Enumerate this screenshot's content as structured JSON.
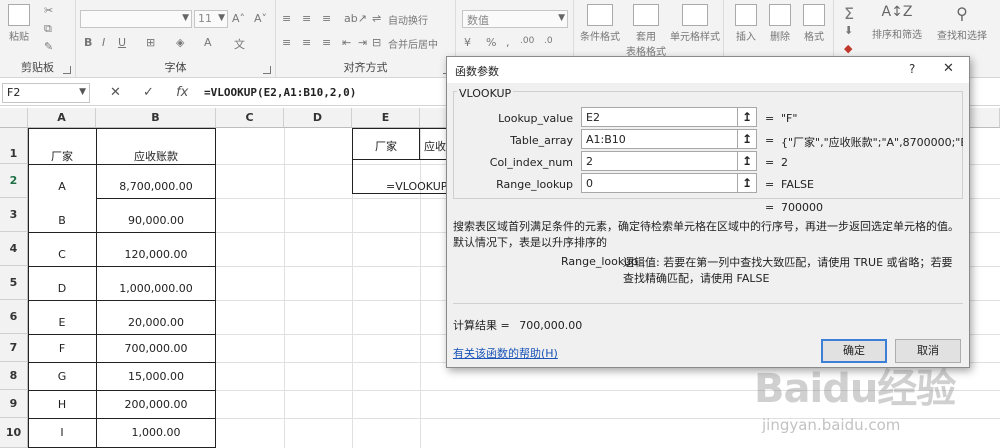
{
  "ribbon": {
    "clipboard": {
      "paste_label": "粘贴",
      "group_label": "剪贴板"
    },
    "font": {
      "font_size": "11",
      "group_label": "字体"
    },
    "alignment": {
      "wrap_label": "自动换行",
      "merge_label": "合并后居中",
      "group_label": "对齐方式"
    },
    "number": {
      "format_value": "数值"
    },
    "styles": {
      "conditional_label": "条件格式",
      "table_label_1": "套用",
      "table_label_2": "表格格式",
      "cell_styles_label": "单元格样式"
    },
    "cells": {
      "insert_label": "插入",
      "delete_label": "删除",
      "format_label": "格式"
    },
    "editing": {
      "sort_label": "排序和筛选",
      "find_label": "查找和选择"
    }
  },
  "formula_bar": {
    "name_box": "F2",
    "fx_label": "fx",
    "formula": "=VLOOKUP(E2,A1:B10,2,0)"
  },
  "grid": {
    "columns": [
      "A",
      "B",
      "C",
      "D",
      "E"
    ],
    "rows": [
      "1",
      "2",
      "3",
      "4",
      "5",
      "6",
      "7",
      "8",
      "9",
      "10"
    ],
    "header_row": {
      "a": "厂家",
      "b": "应收账款"
    },
    "data": [
      {
        "a": "A",
        "b": "8,700,000.00"
      },
      {
        "a": "B",
        "b": "90,000.00"
      },
      {
        "a": "C",
        "b": "120,000.00"
      },
      {
        "a": "D",
        "b": "1,000,000.00"
      },
      {
        "a": "E",
        "b": "20,000.00"
      },
      {
        "a": "F",
        "b": "700,000.00"
      },
      {
        "a": "G",
        "b": "15,000.00"
      },
      {
        "a": "H",
        "b": "200,000.00"
      },
      {
        "a": "I",
        "b": "1,000.00"
      }
    ],
    "e1": "厂家",
    "f1_partial": "应收",
    "e2": "=VLOOKUP"
  },
  "dialog": {
    "title": "函数参数",
    "help_glyph": "?",
    "close_glyph": "✕",
    "function_name": "VLOOKUP",
    "params": [
      {
        "label": "Lookup_value",
        "input": "E2",
        "result": "\"F\""
      },
      {
        "label": "Table_array",
        "input": "A1:B10",
        "result": "{\"厂家\",\"应收账款\";\"A\",8700000;\"B\",900"
      },
      {
        "label": "Col_index_num",
        "input": "2",
        "result": "2"
      },
      {
        "label": "Range_lookup",
        "input": "0",
        "result": "FALSE"
      }
    ],
    "eq": "=",
    "overall_result": "700000",
    "description": "搜索表区域首列满足条件的元素，确定待检索单元格在区域中的行序号，再进一步返回选定单元格的值。默认情况下，表是以升序排序的",
    "arg_name": "Range_lookup",
    "arg_description": "逻辑值: 若要在第一列中查找大致匹配，请使用 TRUE 或省略；若要查找精确匹配，请使用 FALSE",
    "calc_result_label": "计算结果 =",
    "calc_result_value": "700,000.00",
    "help_link": "有关该函数的帮助(H)",
    "ok_label": "确定",
    "cancel_label": "取消"
  },
  "watermark": {
    "logo": "Baidu经验",
    "url": "jingyan.baidu.com"
  }
}
